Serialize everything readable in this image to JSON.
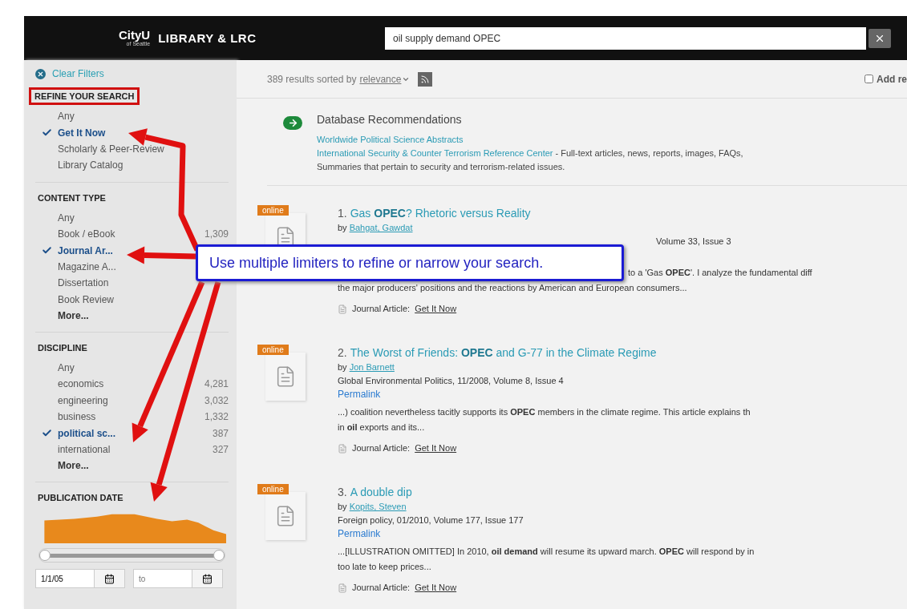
{
  "header": {
    "logo": "CityU",
    "logo_sub": "of Seattle",
    "title": "LIBRARY & LRC",
    "search": {
      "value": "oil supply demand OPEC"
    }
  },
  "sidebar": {
    "clear_filters": "Clear Filters",
    "sections": [
      {
        "title": "REFINE YOUR SEARCH",
        "highlighted": true,
        "items": [
          {
            "label": "Any",
            "checked": false
          },
          {
            "label": "Get It Now",
            "checked": true
          },
          {
            "label": "Scholarly & Peer-Review",
            "checked": false
          },
          {
            "label": "Library Catalog",
            "checked": false
          }
        ]
      },
      {
        "title": "CONTENT TYPE",
        "highlighted": false,
        "items": [
          {
            "label": "Any",
            "checked": false
          },
          {
            "label": "Book / eBook",
            "count": "1,309",
            "checked": false
          },
          {
            "label": "Journal Ar...",
            "checked": true
          },
          {
            "label": "Magazine A...",
            "checked": false
          },
          {
            "label": "Dissertation",
            "checked": false
          },
          {
            "label": "Book Review",
            "checked": false
          }
        ],
        "more": "More..."
      },
      {
        "title": "DISCIPLINE",
        "highlighted": false,
        "items": [
          {
            "label": "Any",
            "checked": false
          },
          {
            "label": "economics",
            "count": "4,281",
            "checked": false
          },
          {
            "label": "engineering",
            "count": "3,032",
            "checked": false
          },
          {
            "label": "business",
            "count": "1,332",
            "checked": false
          },
          {
            "label": "political sc...",
            "count": "387",
            "checked": true
          },
          {
            "label": "international",
            "count": "327",
            "checked": false
          }
        ],
        "more": "More..."
      }
    ],
    "publication_date": {
      "title": "PUBLICATION DATE",
      "slider": {
        "level": 1
      },
      "from": {
        "value": "1/1/05"
      },
      "to": {
        "placeholder": "to"
      }
    }
  },
  "toolbar": {
    "summary": "389 results sorted by",
    "sort": "relevance",
    "add_results": {
      "label": "Add re",
      "checked": false
    }
  },
  "recommendations": {
    "title": "Database Recommendations",
    "link": "Worldwide Political Science Abstracts",
    "entry": {
      "link": "International Security & Counter Terrorism Reference Center",
      "text": " - Full-text articles, news, reports, images, FAQs,"
    },
    "description": "Summaries that pertain to security and terrorism-related issues."
  },
  "results": [
    {
      "badge": "online",
      "number": "1.",
      "title": "Gas **OPEC**? Rhetoric versus Reality",
      "by": "by",
      "author": "Bahgat, Gawdat",
      "source": "Volume 33, Issue 3",
      "covered": true,
      "snippet": [
        "to a 'Gas **OPEC**'. I analyze the fundamental diff",
        "the major producers' positions and the reactions by American and European consumers..."
      ],
      "type": "Journal Article:",
      "access": "Get It Now"
    },
    {
      "badge": "online",
      "number": "2.",
      "title": "The Worst of Friends: **OPEC** and G-77 in the Climate Regime",
      "by": "by",
      "author": "Jon Barnett",
      "source": "Global Environmental Politics, 11/2008, Volume 8, Issue 4",
      "permalink": "Permalink",
      "snippet": [
        "...) coalition nevertheless tacitly supports its **OPEC** members in the climate regime. This article explains th",
        "in **oil** exports and its..."
      ],
      "type": "Journal Article:",
      "access": "Get It Now"
    },
    {
      "badge": "online",
      "number": "3.",
      "title": "A double dip",
      "by": "by",
      "author": "Kopits, Steven",
      "source": "Foreign policy, 01/2010, Volume 177, Issue 177",
      "permalink": "Permalink",
      "snippet": [
        "...[ILLUSTRATION OMITTED] In 2010, **oil demand** will resume its upward march. **OPEC** will respond by in",
        "too late to keep prices..."
      ],
      "type": "Journal Article:",
      "access": "Get It Now"
    }
  ],
  "callout": {
    "text": "Use multiple limiters to refine or narrow your search."
  }
}
